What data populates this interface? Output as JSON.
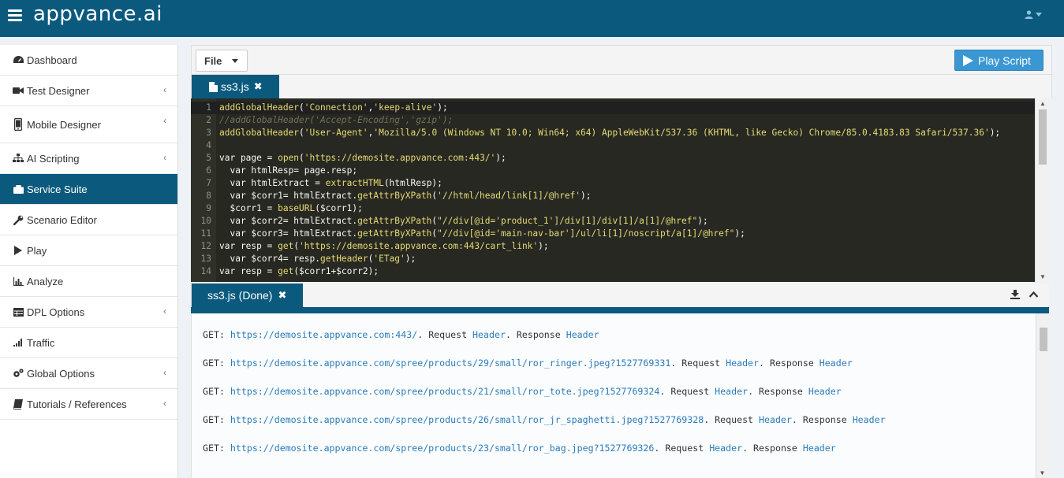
{
  "header": {
    "brand": "appvance.ai",
    "user_menu_icon": "user-icon"
  },
  "sidebar": {
    "items": [
      {
        "label": "Dashboard",
        "icon": "dashboard-icon",
        "has_submenu": false,
        "active": false
      },
      {
        "label": "Test Designer",
        "icon": "video-camera-icon",
        "has_submenu": true,
        "active": false
      },
      {
        "label": "Mobile Designer",
        "icon": "mobile-icon",
        "has_submenu": true,
        "active": false
      },
      {
        "label": "AI Scripting",
        "icon": "sitemap-icon",
        "has_submenu": true,
        "active": false
      },
      {
        "label": "Service Suite",
        "icon": "briefcase-icon",
        "has_submenu": false,
        "active": true
      },
      {
        "label": "Scenario Editor",
        "icon": "wrench-icon",
        "has_submenu": false,
        "active": false
      },
      {
        "label": "Play",
        "icon": "play-icon",
        "has_submenu": false,
        "active": false
      },
      {
        "label": "Analyze",
        "icon": "bar-chart-icon",
        "has_submenu": false,
        "active": false
      },
      {
        "label": "DPL Options",
        "icon": "table-icon",
        "has_submenu": true,
        "active": false
      },
      {
        "label": "Traffic",
        "icon": "signal-icon",
        "has_submenu": false,
        "active": false
      },
      {
        "label": "Global Options",
        "icon": "cogs-icon",
        "has_submenu": true,
        "active": false
      },
      {
        "label": "Tutorials / References",
        "icon": "book-icon",
        "has_submenu": true,
        "active": false
      }
    ]
  },
  "toolbar": {
    "file_label": "File",
    "play_label": "Play Script"
  },
  "editor": {
    "tab_label": "ss3.js",
    "lines": [
      {
        "n": "1",
        "text": "addGlobalHeader('Connection','keep-alive');",
        "type": "code"
      },
      {
        "n": "2",
        "text": "//addGlobalHeader('Accept-Encoding','gzip');",
        "type": "comment"
      },
      {
        "n": "3",
        "text": "addGlobalHeader('User-Agent','Mozilla/5.0 (Windows NT 10.0; Win64; x64) AppleWebKit/537.36 (KHTML, like Gecko) Chrome/85.0.4183.83 Safari/537.36');",
        "type": "code"
      },
      {
        "n": "4",
        "text": "",
        "type": "code"
      },
      {
        "n": "5",
        "text": "var page = open('https://demosite.appvance.com:443/');",
        "type": "code"
      },
      {
        "n": "6",
        "text": "  var htmlResp= page.resp;",
        "type": "code"
      },
      {
        "n": "7",
        "text": "  var htmlExtract = extractHTML(htmlResp);",
        "type": "code"
      },
      {
        "n": "8",
        "text": "  var $corr1= htmlExtract.getAttrByXPath('//html/head/link[1]/@href');",
        "type": "code"
      },
      {
        "n": "9",
        "text": "  $corr1 = baseURL($corr1);",
        "type": "code"
      },
      {
        "n": "10",
        "text": "  var $corr2= htmlExtract.getAttrByXPath(\"//div[@id='product_1']/div[1]/div[1]/a[1]/@href\");",
        "type": "code"
      },
      {
        "n": "11",
        "text": "  var $corr3= htmlExtract.getAttrByXPath(\"//div[@id='main-nav-bar']/ul/li[1]/noscript/a[1]/@href\");",
        "type": "code"
      },
      {
        "n": "12",
        "text": "var resp = get('https://demosite.appvance.com:443/cart_link');",
        "type": "code"
      },
      {
        "n": "13",
        "text": "  var $corr4= resp.getHeader('ETag');",
        "type": "code"
      },
      {
        "n": "14",
        "text": "var resp = get($corr1+$corr2);",
        "type": "code"
      }
    ]
  },
  "output": {
    "tab_label": "ss3.js (Done)",
    "lines": [
      {
        "prefix": "GET: ",
        "url": "https://demosite.appvance.com:443/",
        "mid": ". Request ",
        "req": "Header",
        "mid2": ". Response ",
        "res": "Header"
      },
      {
        "prefix": "GET: ",
        "url": "https://demosite.appvance.com/spree/products/29/small/ror_ringer.jpeg?1527769331",
        "mid": ". Request ",
        "req": "Header",
        "mid2": ". Response ",
        "res": "Header"
      },
      {
        "prefix": "GET: ",
        "url": "https://demosite.appvance.com/spree/products/21/small/ror_tote.jpeg?1527769324",
        "mid": ". Request ",
        "req": "Header",
        "mid2": ". Response ",
        "res": "Header"
      },
      {
        "prefix": "GET: ",
        "url": "https://demosite.appvance.com/spree/products/26/small/ror_jr_spaghetti.jpeg?1527769328",
        "mid": ". Request ",
        "req": "Header",
        "mid2": ". Response ",
        "res": "Header"
      },
      {
        "prefix": "GET: ",
        "url": "https://demosite.appvance.com/spree/products/23/small/ror_bag.jpeg?1527769326",
        "mid": ". Request ",
        "req": "Header",
        "mid2": ". Response ",
        "res": "Header"
      }
    ]
  }
}
